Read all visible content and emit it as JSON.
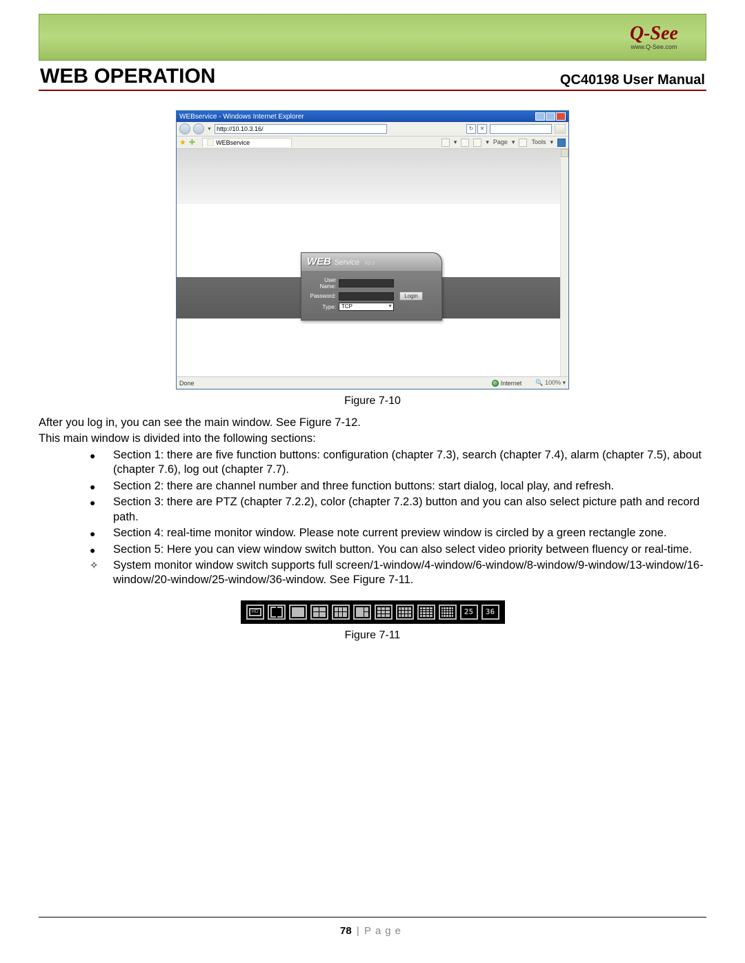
{
  "header": {
    "logo_text": "Q-See",
    "logo_url": "www.Q-See.com",
    "section_title": "WEB OPERATION",
    "manual_title": "QC40198 User Manual"
  },
  "browser": {
    "window_title": "WEBservice - Windows Internet Explorer",
    "address": "http://10.10.3.16/",
    "tab_label": "WEBservice",
    "toolbar_items": {
      "page": "Page",
      "tools": "Tools"
    },
    "status_done": "Done",
    "status_zone": "Internet",
    "status_zoom": "100%"
  },
  "login": {
    "brand_web": "WEB",
    "brand_service": "Service",
    "brand_version": "V2.0",
    "username_label": "User Name:",
    "password_label": "Password:",
    "type_label": "Type:",
    "type_value": "TCP",
    "login_button": "Login"
  },
  "captions": {
    "figure_7_10": "Figure 7-10",
    "figure_7_11": "Figure 7-11"
  },
  "body": {
    "intro1": "After you log in, you can see the main window.  See Figure 7-12.",
    "intro2": "This main window is divided into the following sections:",
    "bullets": [
      "Section 1: there are five function buttons: configuration (chapter 7.3), search (chapter 7.4), alarm (chapter 7.5), about (chapter 7.6), log out (chapter 7.7).",
      "Section 2: there are channel number and three function buttons: start dialog, local play, and refresh.",
      "Section 3: there are PTZ (chapter 7.2.2), color (chapter 7.2.3) button and you can also select picture path and record path.",
      "Section 4: real-time monitor window. Please note current preview window is circled by a green rectangle zone.",
      "Section 5: Here you can view window switch button.  You can also select video priority between fluency or real-time."
    ],
    "diamond": "System monitor window switch supports full screen/1-window/4-window/6-window/8-window/9-window/13-window/16-window/20-window/25-window/36-window. See Figure 7-11."
  },
  "toolbar": {
    "hd": "HD",
    "b25": "25",
    "b36": "36"
  },
  "footer": {
    "page_num": "78",
    "page_word": "Page"
  }
}
